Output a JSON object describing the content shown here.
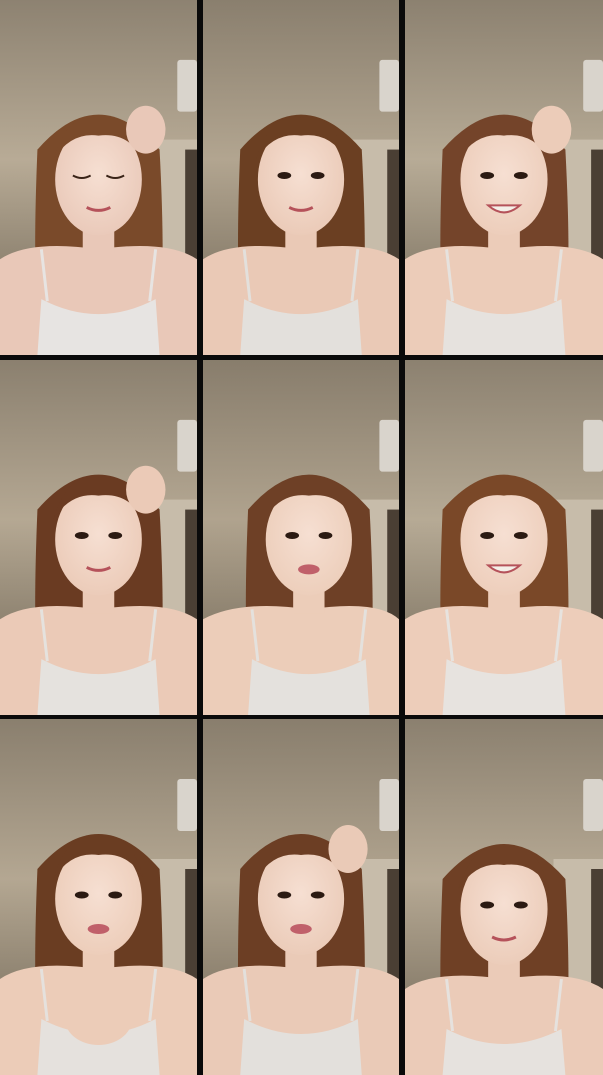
{
  "image": {
    "kind": "photo-collage",
    "rows": 3,
    "cols": 3,
    "background": "#000000",
    "frames": [
      {
        "pose": "hand-on-head",
        "expression": "eyes-closed-smile",
        "palette": {
          "wall": "#b8ab96",
          "ceiling": "#8d8271",
          "hair": "#7a4a2a",
          "skin": "#e9c8b8",
          "top": "#e7e4e2"
        }
      },
      {
        "pose": "neutral",
        "expression": "soft-smile",
        "palette": {
          "wall": "#b2a590",
          "ceiling": "#8a7f6e",
          "hair": "#6b3f22",
          "skin": "#eac9b6",
          "top": "#e3e0dc"
        }
      },
      {
        "pose": "hand-behind-head",
        "expression": "big-smile",
        "palette": {
          "wall": "#b7ab96",
          "ceiling": "#8c8170",
          "hair": "#74442a",
          "skin": "#ecccb9",
          "top": "#e6e2de"
        }
      },
      {
        "pose": "hands-in-hair",
        "expression": "smile",
        "palette": {
          "wall": "#b5a893",
          "ceiling": "#8b806f",
          "hair": "#6a3b22",
          "skin": "#ebcab7",
          "top": "#e5e2de"
        }
      },
      {
        "pose": "head-tilt",
        "expression": "talking",
        "palette": {
          "wall": "#b0a38e",
          "ceiling": "#887d6c",
          "hair": "#6e4026",
          "skin": "#eccdb9",
          "top": "#e4e1dd"
        }
      },
      {
        "pose": "neutral",
        "expression": "big-smile",
        "palette": {
          "wall": "#b6aa95",
          "ceiling": "#8c8170",
          "hair": "#7a4828",
          "skin": "#edcdba",
          "top": "#e7e3df"
        }
      },
      {
        "pose": "hands-clasped",
        "expression": "talking",
        "palette": {
          "wall": "#b4a792",
          "ceiling": "#8a7f6e",
          "hair": "#6a3d22",
          "skin": "#ecccb8",
          "top": "#e5e1dd"
        }
      },
      {
        "pose": "hand-on-head",
        "expression": "talking",
        "palette": {
          "wall": "#b1a48f",
          "ceiling": "#897e6d",
          "hair": "#6c3e24",
          "skin": "#eacab7",
          "top": "#e3e0dc"
        }
      },
      {
        "pose": "looking-down",
        "expression": "smile",
        "palette": {
          "wall": "#b6a994",
          "ceiling": "#8b806f",
          "hair": "#6f4025",
          "skin": "#ebcbb8",
          "top": "#e6e2de"
        }
      }
    ]
  }
}
